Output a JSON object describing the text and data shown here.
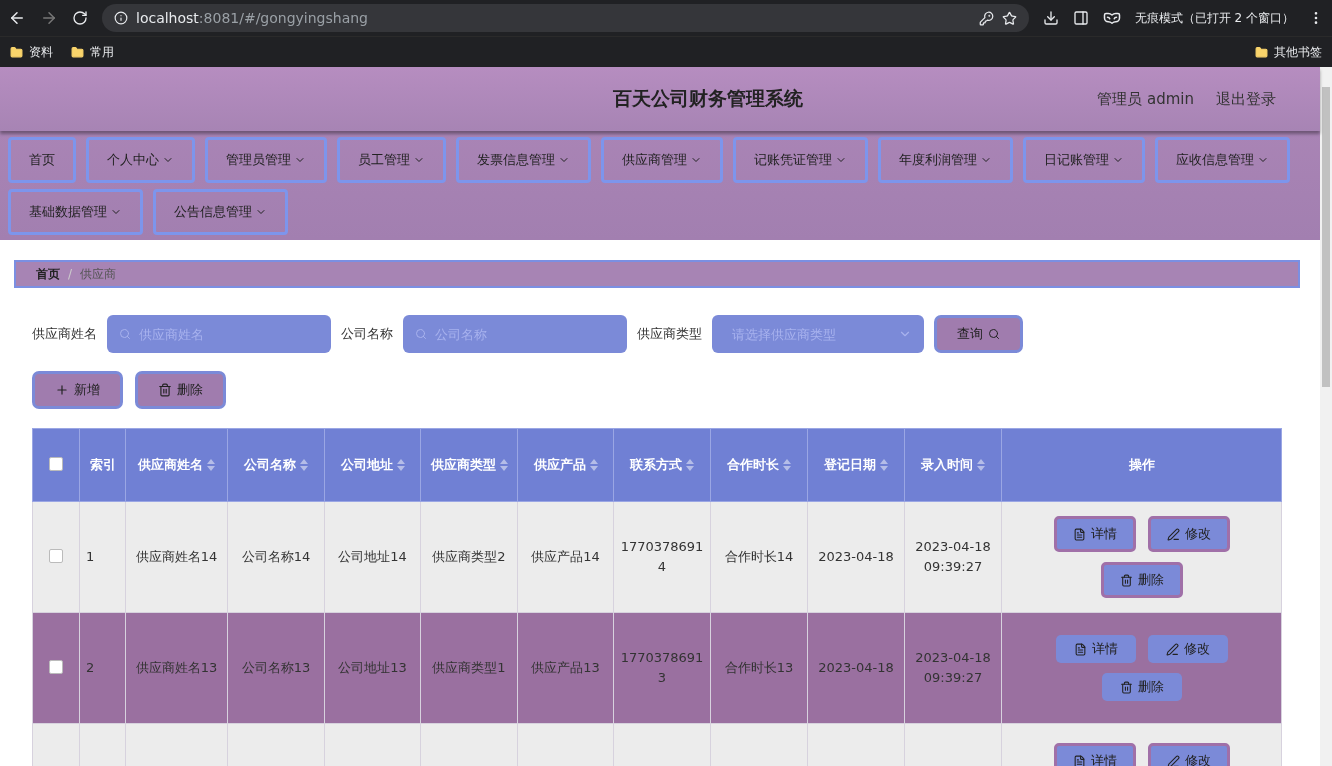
{
  "browser": {
    "url_host": "localhost",
    "url_path": ":8081/#/gongyingshang",
    "incognito": "无痕模式（已打开 2 个窗口）",
    "bookmarks": [
      "资料",
      "常用"
    ],
    "other_bookmarks": "其他书签"
  },
  "header": {
    "title": "百天公司财务管理系统",
    "user": "管理员 admin",
    "logout": "退出登录"
  },
  "nav": [
    {
      "label": "首页",
      "dropdown": false
    },
    {
      "label": "个人中心",
      "dropdown": true
    },
    {
      "label": "管理员管理",
      "dropdown": true
    },
    {
      "label": "员工管理",
      "dropdown": true
    },
    {
      "label": "发票信息管理",
      "dropdown": true
    },
    {
      "label": "供应商管理",
      "dropdown": true
    },
    {
      "label": "记账凭证管理",
      "dropdown": true
    },
    {
      "label": "年度利润管理",
      "dropdown": true
    },
    {
      "label": "日记账管理",
      "dropdown": true
    },
    {
      "label": "应收信息管理",
      "dropdown": true
    },
    {
      "label": "基础数据管理",
      "dropdown": true
    },
    {
      "label": "公告信息管理",
      "dropdown": true
    }
  ],
  "breadcrumb": {
    "items": [
      "首页",
      "供应商"
    ],
    "separator": "/"
  },
  "filters": [
    {
      "kind": "text",
      "label": "供应商姓名",
      "placeholder": "供应商姓名"
    },
    {
      "kind": "text",
      "label": "公司名称",
      "placeholder": "公司名称"
    },
    {
      "kind": "select",
      "label": "供应商类型",
      "placeholder": "请选择供应商类型"
    }
  ],
  "search_button": "查询",
  "actions": [
    {
      "kind": "add",
      "label": "新增"
    },
    {
      "kind": "delete",
      "label": "删除"
    }
  ],
  "table": {
    "select_all": {
      "checked": false
    },
    "columns": [
      {
        "label": "索引",
        "sortable": false
      },
      {
        "label": "供应商姓名",
        "sortable": true
      },
      {
        "label": "公司名称",
        "sortable": true
      },
      {
        "label": "公司地址",
        "sortable": true
      },
      {
        "label": "供应商类型",
        "sortable": true
      },
      {
        "label": "供应产品",
        "sortable": true
      },
      {
        "label": "联系方式",
        "sortable": true
      },
      {
        "label": "合作时长",
        "sortable": true
      },
      {
        "label": "登记日期",
        "sortable": true
      },
      {
        "label": "录入时间",
        "sortable": true
      },
      {
        "label": "操作",
        "sortable": false
      }
    ],
    "rows": [
      {
        "checked": false,
        "cells": [
          "1",
          "供应商姓名14",
          "公司名称14",
          "公司地址14",
          "供应商类型2",
          "供应产品14",
          "17703786914",
          "合作时长14",
          "2023-04-18",
          "2023-04-18 09:39:27"
        ],
        "buttons": [
          {
            "kind": "detail",
            "label": "详情"
          },
          {
            "kind": "edit",
            "label": "修改"
          },
          {
            "kind": "delete",
            "label": "删除"
          }
        ]
      },
      {
        "checked": false,
        "cells": [
          "2",
          "供应商姓名13",
          "公司名称13",
          "公司地址13",
          "供应商类型1",
          "供应产品13",
          "17703786913",
          "合作时长13",
          "2023-04-18",
          "2023-04-18 09:39:27"
        ],
        "buttons": [
          {
            "kind": "detail",
            "label": "详情"
          },
          {
            "kind": "edit",
            "label": "修改"
          },
          {
            "kind": "delete",
            "label": "删除"
          }
        ]
      },
      {
        "buttons": [
          {
            "kind": "detail",
            "label": "详情"
          },
          {
            "kind": "edit",
            "label": "修改"
          }
        ]
      }
    ]
  }
}
